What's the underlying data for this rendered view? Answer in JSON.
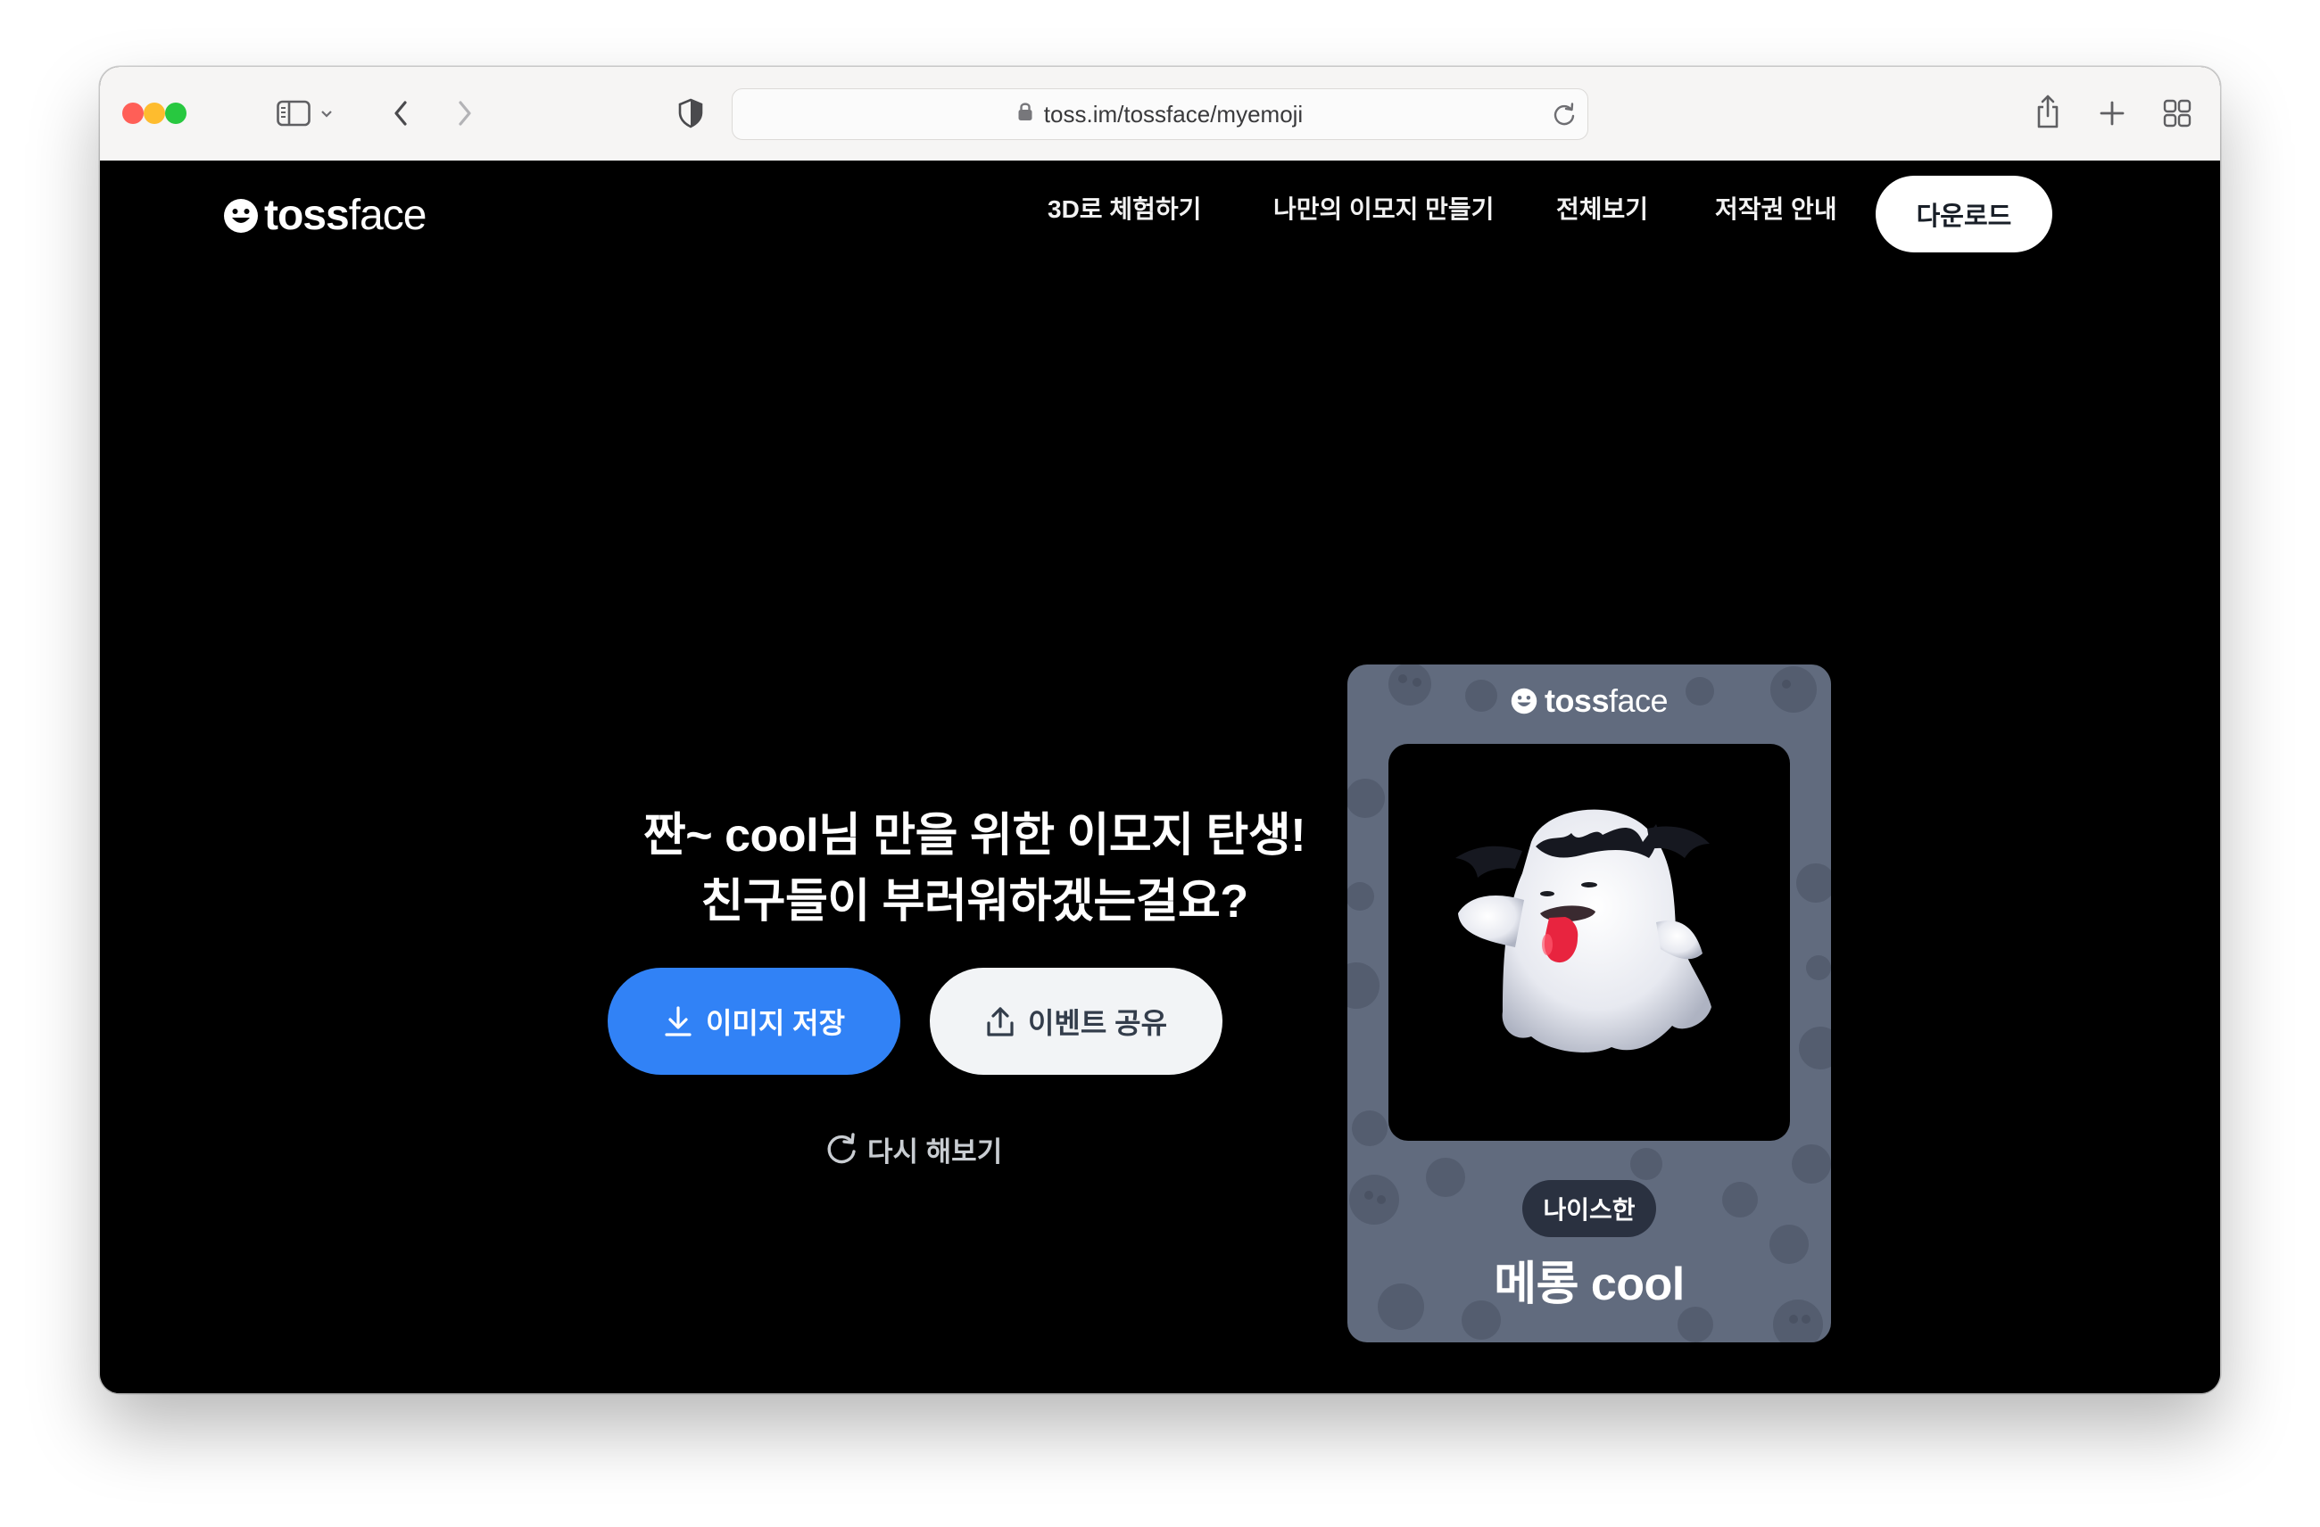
{
  "browser": {
    "url": "toss.im/tossface/myemoji",
    "icons": {
      "sidebar": "sidebar-icon",
      "back": "chevron-left-icon",
      "forward": "chevron-right-icon",
      "privacy": "shield-icon",
      "lock": "lock-icon",
      "reload": "reload-icon",
      "share": "share-icon",
      "new_tab": "plus-icon",
      "tab_overview": "tab-grid-icon"
    },
    "traffic_lights": [
      "#ff5f57",
      "#febc2e",
      "#28c840"
    ]
  },
  "site": {
    "logo_bold": "toss",
    "logo_light": "face",
    "nav": [
      {
        "label": "3D로 체험하기"
      },
      {
        "label": "나만의 이모지 만들기"
      },
      {
        "label": "전체보기"
      },
      {
        "label": "저작권 안내"
      }
    ],
    "download_label": "다운로드"
  },
  "main": {
    "headline_line1": "짠~ cool님 만을 위한 이모지 탄생!",
    "headline_line2": "친구들이 부러워하겠는걸요?",
    "save_label": "이미지 저장",
    "share_label": "이벤트 공유",
    "retry_label": "다시 해보기"
  },
  "card": {
    "logo_bold": "toss",
    "logo_light": "face",
    "emoji": "ghost-with-bat-and-tongue",
    "badge": "나이스한",
    "name": "메롱 cool"
  },
  "colors": {
    "primary": "#3182f6",
    "card_bg": "#616b7e",
    "page_bg": "#000000"
  }
}
